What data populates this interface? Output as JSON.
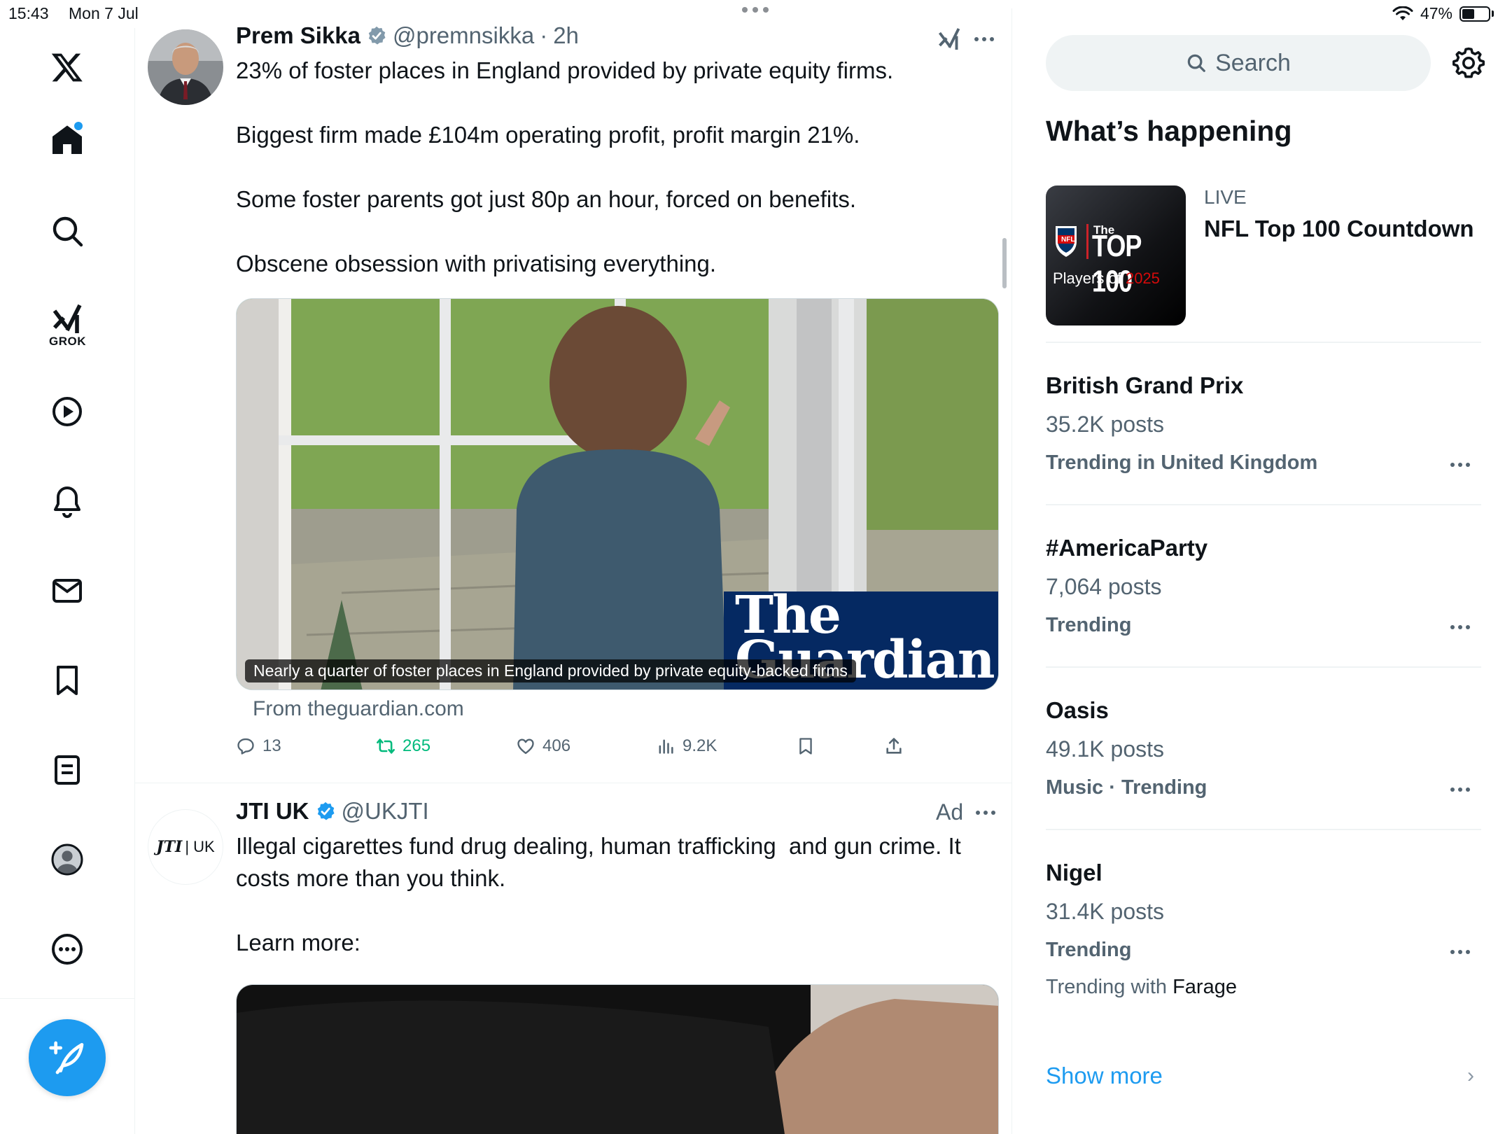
{
  "status_bar": {
    "time": "15:43",
    "date": "Mon 7 Jul",
    "battery": "47%",
    "battery_level": 0.47
  },
  "nav": {
    "grok_label": "GROK"
  },
  "tweets": [
    {
      "author": "Prem Sikka",
      "handle": "@premnsikka",
      "dot": "·",
      "time": "2h",
      "text": "23% of foster places in England provided by private equity firms.\n\nBiggest firm made £104m operating profit, profit margin 21%.\n\nSome foster parents got just 80p an hour, forced on benefits.\n\nObscene obsession with privatising everything.",
      "card": {
        "caption": "Nearly a quarter of foster places in England provided by private equity-backed firms",
        "brand_line1": "The",
        "brand_line2": "Guardian",
        "from": "From theguardian.com"
      },
      "actions": {
        "replies": "13",
        "reposts": "265",
        "likes": "406",
        "views": "9.2K"
      }
    },
    {
      "author": "JTI UK",
      "handle": "@UKJTI",
      "ad_label": "Ad",
      "avatar_text_a": "JTI",
      "avatar_text_b": "| UK",
      "text": "Illegal cigarettes fund drug dealing, human trafficking  and gun crime. It costs more than you think.\n\nLearn more:"
    }
  ],
  "sidebar": {
    "search_placeholder": "Search",
    "title": "What’s happening",
    "live": {
      "label": "LIVE",
      "title": "NFL Top 100 Countdown",
      "thumb_the": "The",
      "thumb_top100": "TOP 100",
      "thumb_players": "Players of",
      "thumb_year": "2025",
      "thumb_nfl": "NFL"
    },
    "trends": [
      {
        "name": "British Grand Prix",
        "posts": "35.2K posts",
        "context": "Trending in United Kingdom"
      },
      {
        "name": "#AmericaParty",
        "posts": "7,064 posts",
        "context": "Trending"
      },
      {
        "name": "Oasis",
        "posts": "49.1K posts",
        "context": "Music · Trending"
      },
      {
        "name": "Nigel",
        "posts": "31.4K posts",
        "context": "Trending",
        "with_prefix": "Trending with",
        "with_name": "Farage"
      }
    ],
    "show_more": "Show more",
    "chevron": "›"
  },
  "colors": {
    "accent": "#1d9bf0",
    "repost_green": "#00ba7c",
    "muted": "#536471",
    "guardian_blue": "#052962"
  }
}
